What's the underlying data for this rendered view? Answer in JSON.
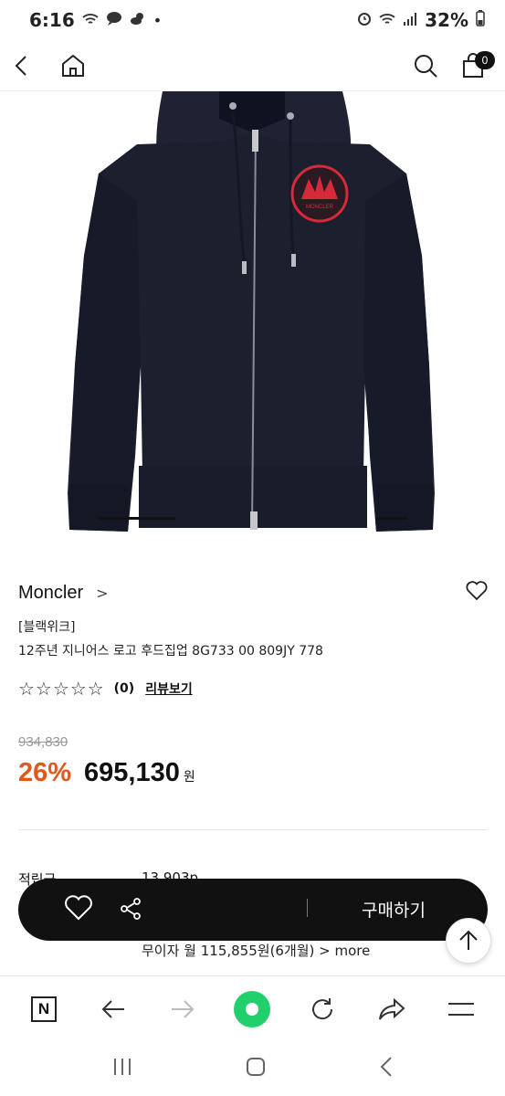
{
  "status_bar": {
    "time": "6:16",
    "battery": "32%"
  },
  "nav": {
    "cart_count": "0"
  },
  "product": {
    "brand": "Moncler",
    "brand_chevron": ">",
    "tag": "[블랙위크]",
    "name": "12주년 지니어스 로고 후드집업 8G733 00 809JY 778",
    "stars": "☆☆☆☆☆",
    "review_count": "(0)",
    "review_link": "리뷰보기",
    "original_price": "934,830",
    "discount": "26%",
    "price": "695,130",
    "currency": "원",
    "points_label": "적립금",
    "points_value": "13,903p",
    "installment": "무이자 월 115,855원(6개월) > more"
  },
  "buy_bar": {
    "buy_label": "구매하기"
  },
  "colors": {
    "accent_discount": "#e4571a",
    "buy_bar_bg": "#111111",
    "browser_green": "#22cf6d"
  }
}
